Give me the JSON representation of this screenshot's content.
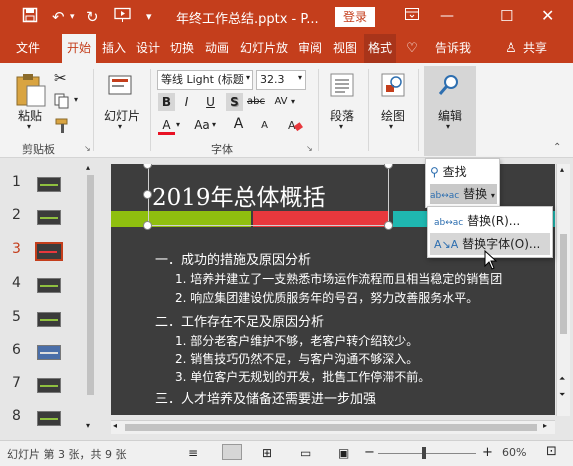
{
  "titlebar": {
    "title": "年终工作总结.pptx - P...",
    "login_label": "登录"
  },
  "tabs": [
    "文件",
    "开始",
    "插入",
    "设计",
    "切换",
    "动画",
    "幻灯片放",
    "审阅",
    "视图",
    "格式",
    "告诉我",
    "共享"
  ],
  "ribbon": {
    "clipboard": {
      "paste_label": "粘贴",
      "group_label": "剪贴板"
    },
    "slides": {
      "label": "幻灯片"
    },
    "font": {
      "name": "等线 Light (标题",
      "size": "32.3",
      "group_label": "字体",
      "bold": "B",
      "italic": "I",
      "underline": "U",
      "shadow": "S",
      "strike": "abc",
      "spacing": "AV",
      "fontcolor": "A",
      "aa": "Aa",
      "grow": "A",
      "shrink": "A"
    },
    "paragraph": {
      "label": "段落"
    },
    "drawing": {
      "label": "绘图"
    },
    "editing": {
      "label": "编辑"
    }
  },
  "edit_panel": {
    "find": "查找",
    "replace": "替换"
  },
  "submenu": {
    "replace": "替换(R)...",
    "replace_font": "替换字体(O)..."
  },
  "thumbnails": [
    "1",
    "2",
    "3",
    "4",
    "5",
    "6",
    "7",
    "8"
  ],
  "slide": {
    "title": "2019年总体概括",
    "lines": [
      "一．成功的措施及原因分析",
      "1.   培养并建立了一支熟悉市场运作流程而且相当稳定的销售团",
      "2.   响应集团建设优质服务年的号召，努力改善服务水平。",
      "二．工作存在不足及原因分析",
      "1.   部分老客户维护不够，老客户转介绍较少。",
      "2.   销售技巧仍然不足，与客户沟通不够深入。",
      "3.   单位客户无规划的开发，批售工作停滞不前。",
      "三．人才培养及储备还需要进一步加强"
    ]
  },
  "status": {
    "slide_info": "幻灯片 第 3 张，共 9 张",
    "zoom": "60%"
  },
  "colors": {
    "accent": "#c43e1c",
    "band_green": "#8fbf0f",
    "band_red": "#e8383d",
    "band_teal": "#1fb7b0",
    "slide_bg": "#3d3d3d"
  }
}
